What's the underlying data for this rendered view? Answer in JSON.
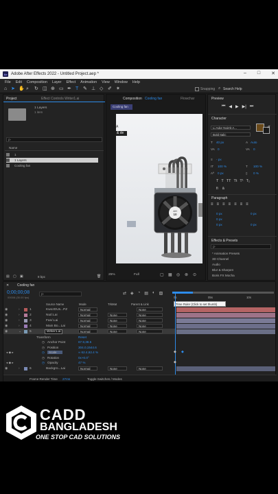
{
  "window": {
    "title": "Adobe After Effects 2022 - Untitled Project.aep *",
    "logo": "Ae",
    "btn_min": "–",
    "btn_max": "□",
    "btn_close": "✕"
  },
  "menu": [
    "File",
    "Edit",
    "Composition",
    "Layer",
    "Effect",
    "Animation",
    "View",
    "Window",
    "Help"
  ],
  "toolbar": {
    "snapping": "Snapping",
    "search_help": "Search Help"
  },
  "project": {
    "tab": "Project",
    "effect_controls": "Effect Controls Writer1.ai",
    "layers_count": "1 Layers",
    "items": "1 item",
    "search_placeholder": "ρ·",
    "name_header": "Name",
    "items_list": [
      {
        "name": "1"
      },
      {
        "name": "1 Layers"
      },
      {
        "name": "Cooling fan"
      }
    ],
    "bpc": "8 bpc"
  },
  "composition": {
    "tab": "Composition",
    "comp_name": "Cooling fan",
    "flowchart": "Flowchar",
    "breadcrumb": "Cooling fan",
    "zoom": "25%",
    "quality": "Full",
    "overlay_a": "A",
    "overlay_b": "& de"
  },
  "preview": {
    "title": "Preview"
  },
  "character": {
    "title": "Character",
    "font": "Li Ador Noirrit A...",
    "style": "Bold Italic",
    "size": "40 px",
    "leading": "Auto",
    "tracking": "0",
    "kerning": "0",
    "px_a": "- px",
    "scale_v": "100 %",
    "scale_h": "100 %",
    "baseline": "0 px",
    "tsume": "0 %"
  },
  "paragraph": {
    "title": "Paragraph",
    "indent_left": "0 px",
    "indent_right": "0 px",
    "indent_first": "0 px",
    "space_before": "0 px",
    "space_after": "0 px"
  },
  "effects": {
    "title": "Effects & Presets",
    "search": "ρ·",
    "items": [
      "* Animation Presets",
      "3D Channel",
      "Audio",
      "Blur & Sharpen",
      "Boris FX Mocha"
    ]
  },
  "timeline": {
    "tab": "Cooling fan",
    "timecode": "0;00;00;08",
    "frames": "00008 (30.00 fps)",
    "search": "ρ·",
    "col_source": "Source Name",
    "col_mode": "Mode",
    "col_trkmat": "TrkMat",
    "col_parent": "Parent & Link",
    "ruler": {
      "start": "0s",
      "mid": "05s",
      "end": "10s"
    },
    "tooltip": "Time Ruler (Click to set thumb)",
    "layers": [
      {
        "num": "1",
        "name": "KwozDUs...PZ",
        "mode": "Normal",
        "trkmat": "",
        "parent": "None",
        "color": "#b55a5a"
      },
      {
        "num": "2",
        "name": "Nut/.Lai",
        "mode": "Normal",
        "trkmat": "None",
        "parent": "None",
        "color": "#b57a9a"
      },
      {
        "num": "3",
        "name": "Fan/.Lai",
        "mode": "Normal",
        "trkmat": "None",
        "parent": "None",
        "color": "#9a9ab5"
      },
      {
        "num": "4",
        "name": "Main Bo...Lai",
        "mode": "Normal",
        "trkmat": "None",
        "parent": "None",
        "color": "#9a7ab5"
      },
      {
        "num": "5",
        "name": "Writer1.ai",
        "mode": "Normal",
        "trkmat": "None",
        "parent": "None",
        "color": "#7a9ab5"
      }
    ],
    "transform": "Transform",
    "reset": "Reset",
    "props": [
      {
        "name": "Anchor Point",
        "value": "67.9,38.5"
      },
      {
        "name": "Position",
        "value": "304.0,1544.6"
      },
      {
        "name": "Scale",
        "value": "∞ 62.4,62.4 %"
      },
      {
        "name": "Rotation",
        "value": "0x+0.0°"
      },
      {
        "name": "Opacity",
        "value": "47 %"
      }
    ],
    "layer6": {
      "num": "6",
      "name": "Backgro...Lai",
      "mode": "Normal",
      "trkmat": "None",
      "parent": "None"
    },
    "render_time_label": "Frame Render Time",
    "render_time": "27ms",
    "toggle": "Toggle Switches / Modes"
  },
  "brand": {
    "name_line1": "CADD",
    "name_line2": "BANGLADESH",
    "tagline": "ONE STOP CAD SOLUTIONS"
  }
}
